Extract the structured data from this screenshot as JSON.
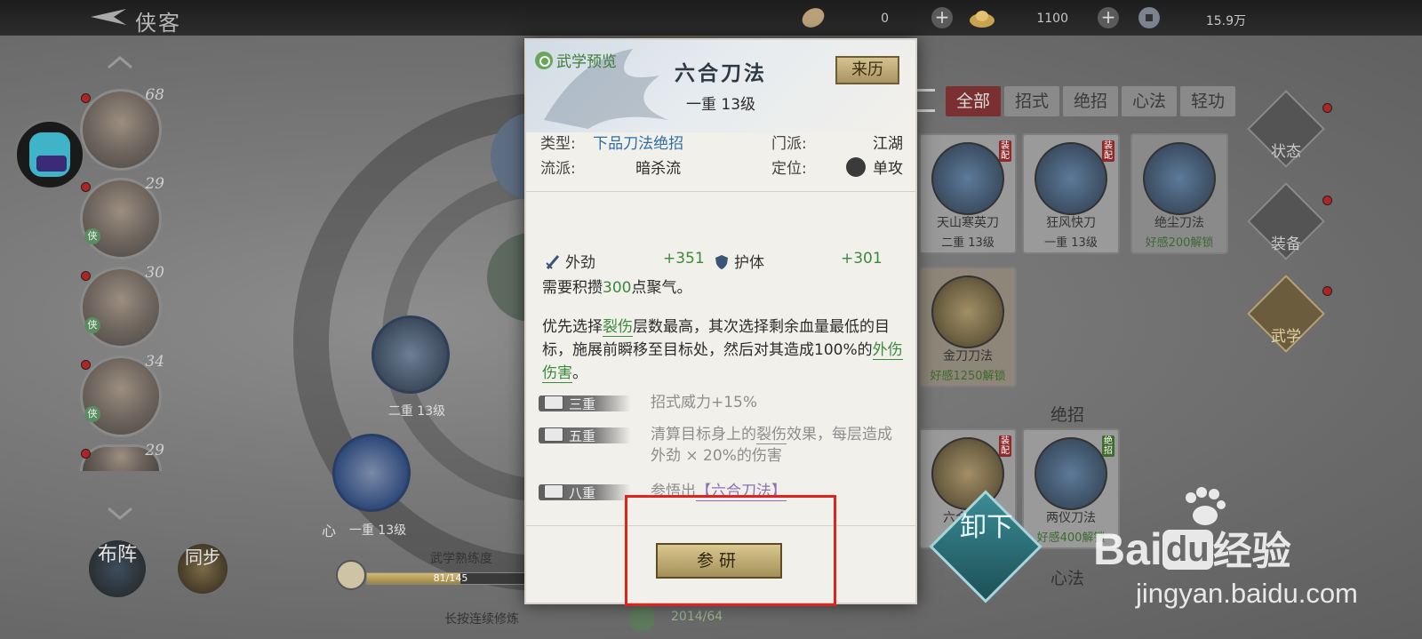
{
  "topbar": {
    "title": "侠客",
    "resources": [
      {
        "icon": "leaf-coin-icon",
        "value": "0"
      },
      {
        "icon": "gold-ingot-icon",
        "value": "1100"
      },
      {
        "icon": "silver-coin-icon",
        "value": "15.9万"
      }
    ]
  },
  "heroes": [
    {
      "level": "68",
      "has_dot": true
    },
    {
      "level": "29",
      "has_dot": true
    },
    {
      "level": "30",
      "has_dot": true
    },
    {
      "level": "34",
      "has_dot": true
    },
    {
      "level": "29",
      "has_dot": true
    }
  ],
  "scene": {
    "node_label_1": "二重 13级",
    "node_label_2": "一重 13级",
    "node_mark_xin": "心",
    "buzhen": "布阵",
    "tongbu": "同步",
    "mastery_title": "武学熟练度",
    "mastery_value": "81/145",
    "mastery_fraction": 0.56,
    "hold_hint": "长按连续修炼",
    "count_value": "2014/64"
  },
  "tabs": [
    "全部",
    "招式",
    "绝招",
    "心法",
    "轻功"
  ],
  "active_tab": 0,
  "cards": [
    {
      "name": "天山寒英刀",
      "sub": "二重 13级",
      "tag": "装配"
    },
    {
      "name": "狂风快刀",
      "sub": "一重 13级",
      "tag": "装配"
    },
    {
      "name": "绝尘刀法",
      "sub": "好感200解锁",
      "tag": ""
    },
    {
      "name": "金刀刀法",
      "sub": "好感1250解锁",
      "tag": ""
    },
    {
      "name": "六合刀法",
      "sub": "",
      "tag": "装配"
    },
    {
      "name": "两仪刀法",
      "sub": "好感400解锁",
      "tag": "绝招"
    }
  ],
  "section_titles": {
    "ultimate": "绝招",
    "xinfa": "心法"
  },
  "side_nav": [
    "状态",
    "装备",
    "武学"
  ],
  "modal": {
    "preview_tag": "武学预览",
    "skill_name": "六合刀法",
    "rank": "一重 13级",
    "origin_button": "来历",
    "type_key": "类型:",
    "type_val": "下品刀法绝招",
    "school_key": "门派:",
    "school_val": "江湖",
    "style_key": "流派:",
    "style_val": "暗杀流",
    "role_key": "定位:",
    "role_val": "单攻",
    "stat1_name": "外劲",
    "stat1_val": "+351",
    "stat2_name": "护体",
    "stat2_val": "+301",
    "require_a": "需要积攒",
    "require_num": "300",
    "require_b": "点聚气。",
    "desc_a": "优先选择",
    "desc_b": "裂伤",
    "desc_c": "层数最高，其次选择剩余血量最低的目标，施展前瞬移至目标处，然后对其造成100%的",
    "desc_d": "外伤伤害",
    "desc_e": "。",
    "tiers": [
      {
        "label": "三重",
        "text": "招式威力+15%"
      },
      {
        "label": "五重",
        "text_a": "清算目标身上的",
        "text_b": "裂伤",
        "text_c": "效果，每层造成外劲 × 20%的伤害"
      },
      {
        "label": "八重",
        "text_a": "参悟出",
        "text_b": "【六合刀法】"
      }
    ],
    "research_button": "参研"
  },
  "unequip_label": "卸下",
  "watermark": {
    "brand": "Bai",
    "brand2": "du",
    "brand3": "经验",
    "url": "jingyan.baidu.com"
  }
}
